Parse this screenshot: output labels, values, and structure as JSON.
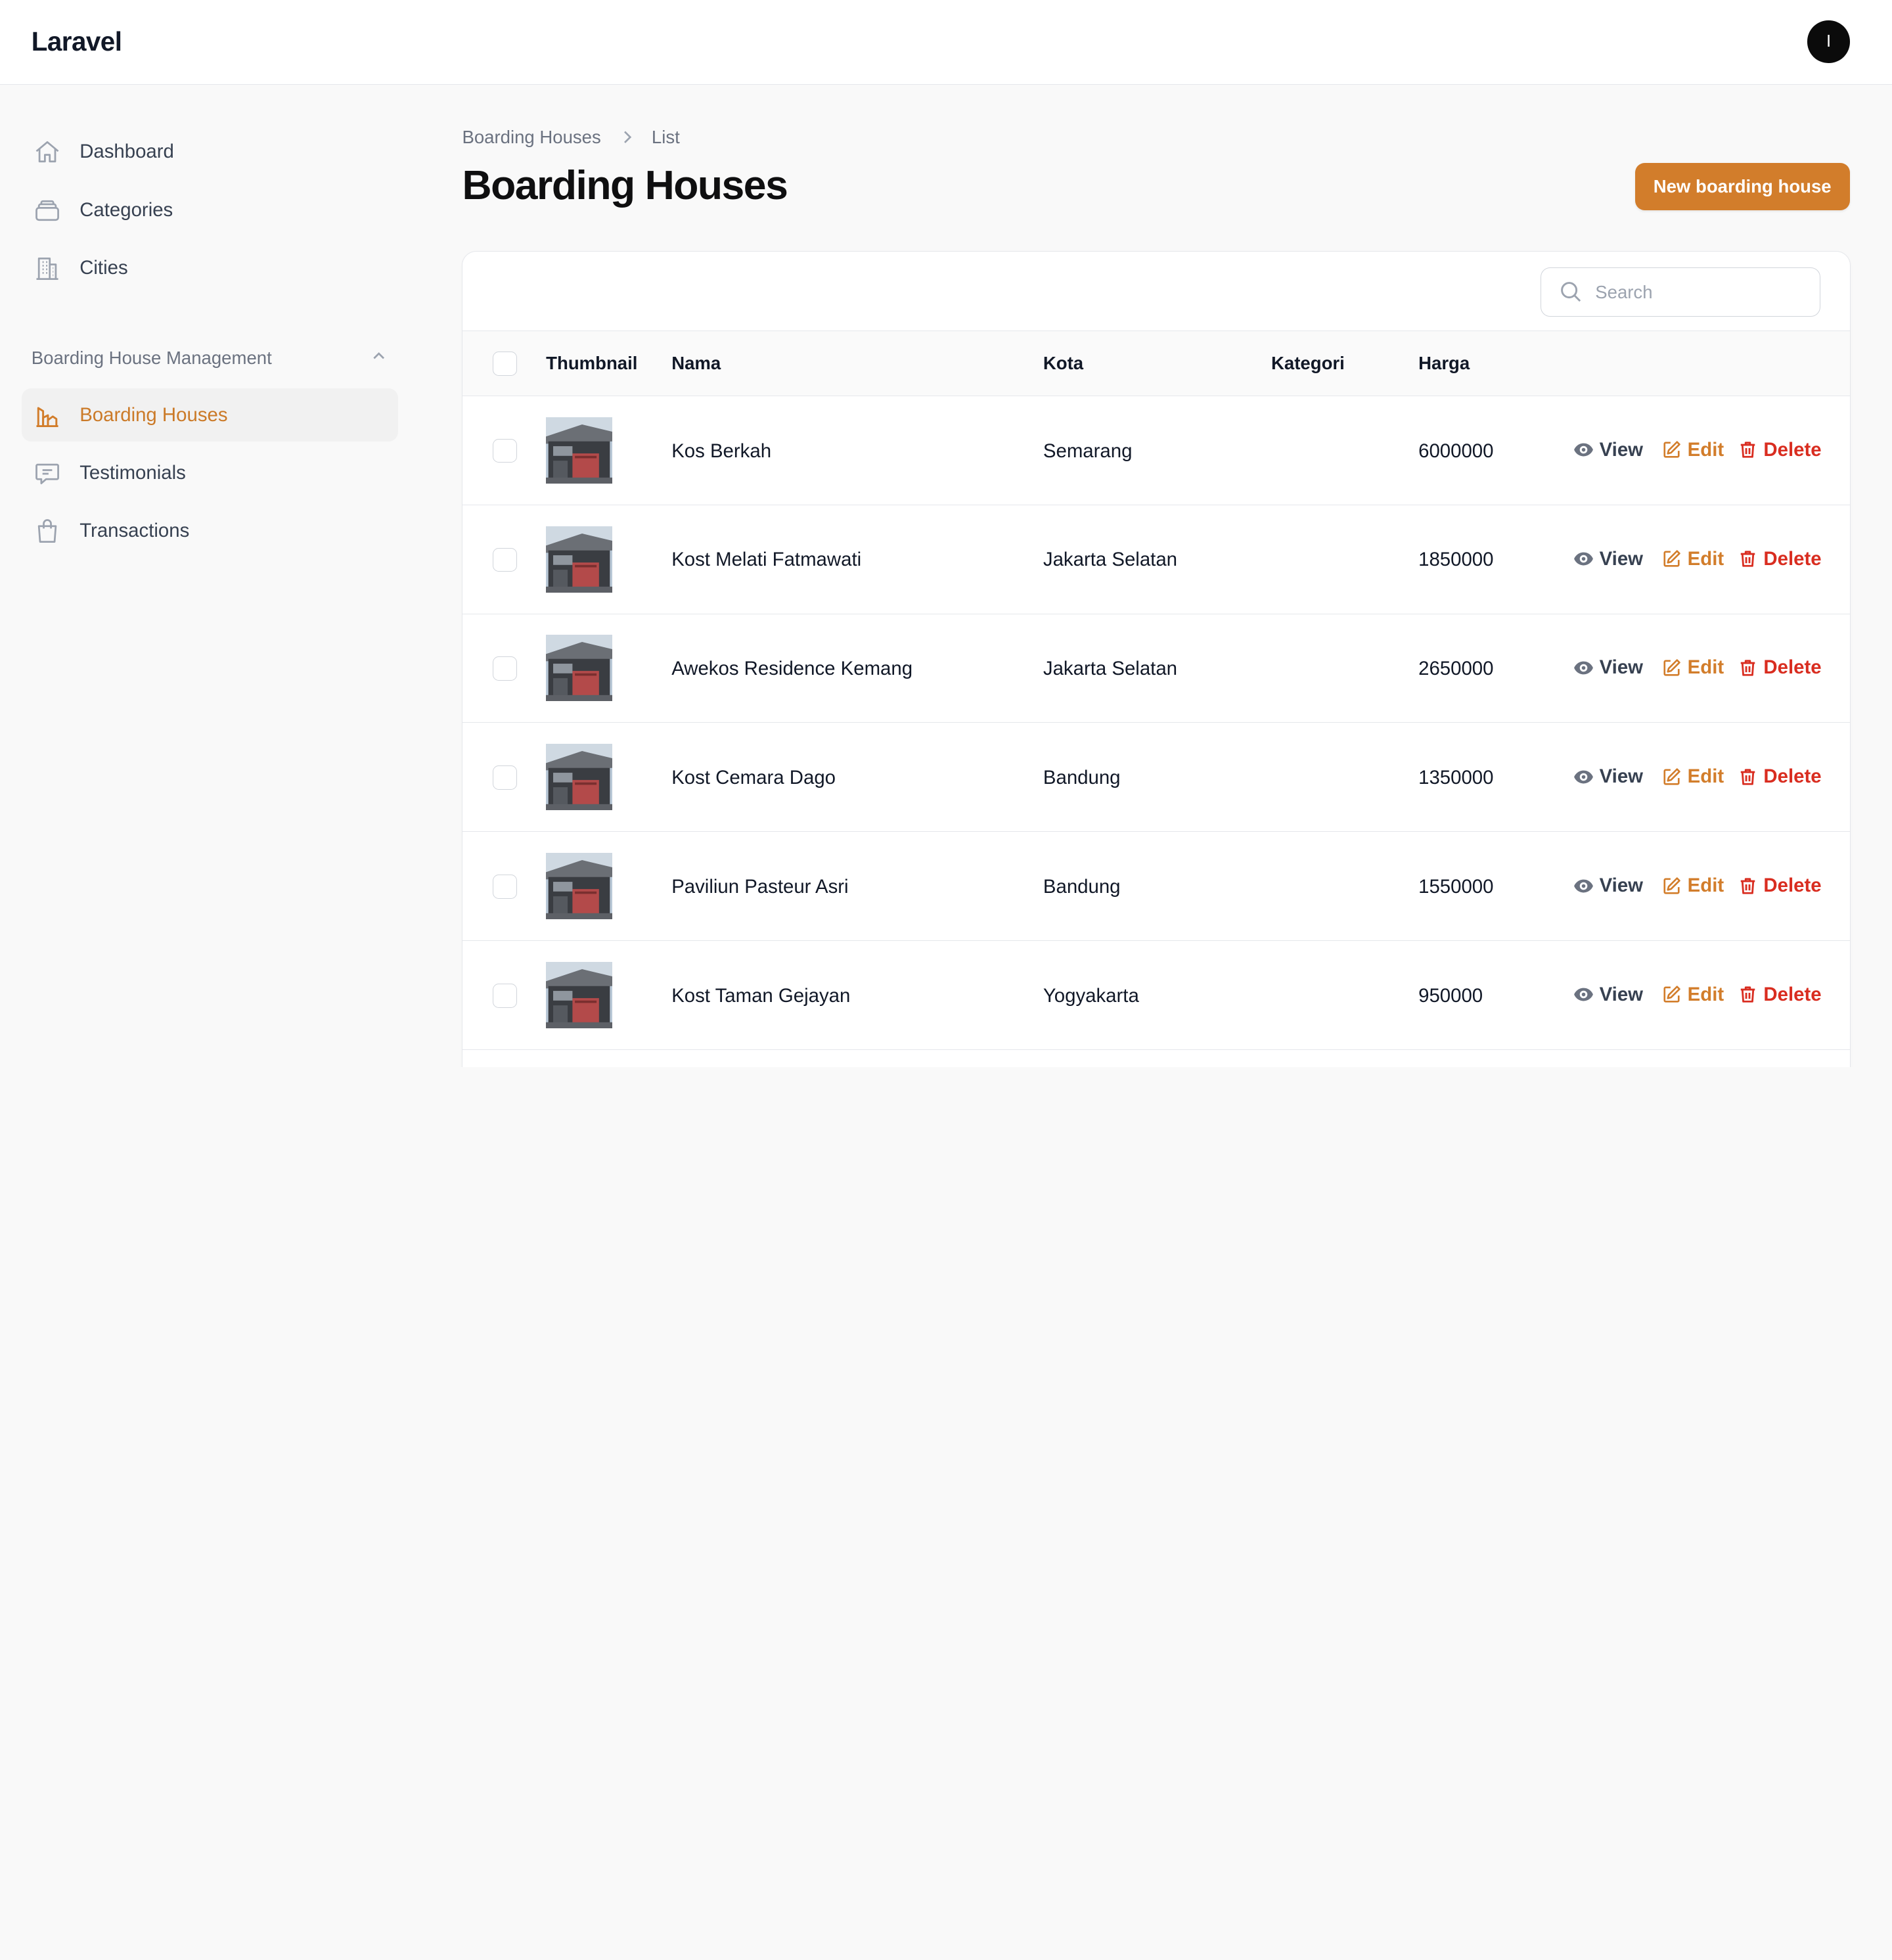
{
  "app": {
    "brand": "Laravel",
    "avatar_initial": "I"
  },
  "sidebar": {
    "items": [
      {
        "label": "Dashboard",
        "icon": "home-icon"
      },
      {
        "label": "Categories",
        "icon": "stack-icon"
      },
      {
        "label": "Cities",
        "icon": "building-icon"
      }
    ],
    "group": {
      "label": "Boarding House Management",
      "items": [
        {
          "label": "Boarding Houses",
          "icon": "chart-building-icon",
          "active": true
        },
        {
          "label": "Testimonials",
          "icon": "chat-icon"
        },
        {
          "label": "Transactions",
          "icon": "shopping-bag-icon"
        }
      ]
    }
  },
  "breadcrumb": {
    "parent": "Boarding Houses",
    "current": "List"
  },
  "page": {
    "title": "Boarding Houses",
    "new_button": "New boarding house"
  },
  "search": {
    "placeholder": "Search"
  },
  "table": {
    "columns": {
      "thumbnail": "Thumbnail",
      "nama": "Nama",
      "kota": "Kota",
      "kategori": "Kategori",
      "harga": "Harga"
    },
    "actions": {
      "view": "View",
      "edit": "Edit",
      "delete": "Delete"
    },
    "rows": [
      {
        "nama": "Kos Berkah",
        "kota": "Semarang",
        "kategori": "",
        "harga": "6000000"
      },
      {
        "nama": "Kost Melati Fatmawati",
        "kota": "Jakarta Selatan",
        "kategori": "",
        "harga": "1850000"
      },
      {
        "nama": "Awekos Residence Kemang",
        "kota": "Jakarta Selatan",
        "kategori": "",
        "harga": "2650000"
      },
      {
        "nama": "Kost Cemara Dago",
        "kota": "Bandung",
        "kategori": "",
        "harga": "1350000"
      },
      {
        "nama": "Paviliun Pasteur Asri",
        "kota": "Bandung",
        "kategori": "",
        "harga": "1550000"
      },
      {
        "nama": "Kost Taman Gejayan",
        "kota": "Yogyakarta",
        "kategori": "",
        "harga": "950000"
      }
    ]
  },
  "colors": {
    "accent": "#d27d2b",
    "danger": "#d92d20",
    "active_nav_text": "#cb7a28"
  }
}
